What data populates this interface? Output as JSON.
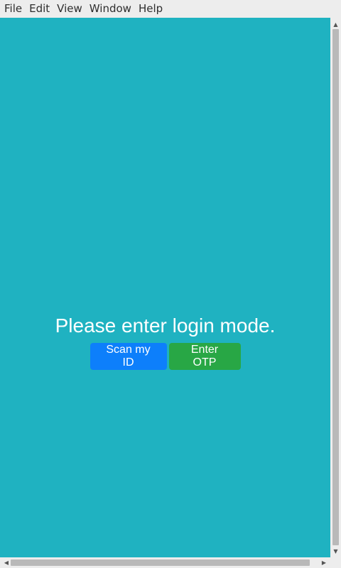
{
  "menu": {
    "items": [
      "File",
      "Edit",
      "View",
      "Window",
      "Help"
    ]
  },
  "login": {
    "prompt": "Please enter login mode.",
    "scan_id_label": "Scan my ID",
    "enter_otp_label": "Enter OTP"
  },
  "colors": {
    "background": "#1fb2c1",
    "primary_button": "#0d7ffb",
    "success_button": "#28a745"
  },
  "icons": {
    "scroll_up": "triangle-up",
    "scroll_down": "triangle-down",
    "scroll_left": "triangle-left",
    "scroll_right": "triangle-right"
  }
}
